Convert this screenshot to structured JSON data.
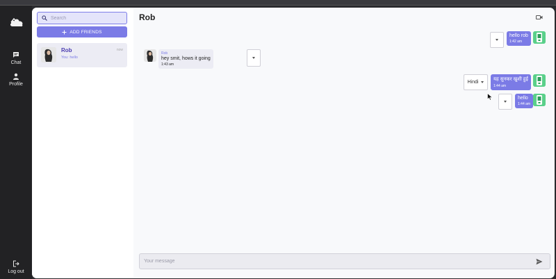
{
  "rail": {
    "chat_label": "Chat",
    "profile_label": "Profile",
    "logout_label": "Log out"
  },
  "friends_panel": {
    "search_placeholder": "Search",
    "add_friends_label": "ADD FRIENDS",
    "friends": [
      {
        "name": "Rob",
        "preview": "You: hello",
        "time": "now"
      }
    ]
  },
  "chat": {
    "title": "Rob",
    "messages": [
      {
        "direction": "outgoing",
        "text": "hello rob",
        "time": "1:42 am"
      },
      {
        "direction": "incoming",
        "sender": "Rob",
        "text": "hey smit, hows it going",
        "time": "1:43 am"
      },
      {
        "direction": "outgoing",
        "text": "यह सुनकर खुशी हुई",
        "time": "1:44 am",
        "language": "Hindi"
      },
      {
        "direction": "outgoing",
        "text": "hello",
        "time": "1:44 am"
      }
    ],
    "compose_placeholder": "Your message"
  },
  "colors": {
    "accent": "#7b7be6",
    "rail_bg": "#222224",
    "avatar_green": "#5ad08a"
  },
  "icons": [
    "cloud-logo-icon",
    "chat-icon",
    "profile-icon",
    "logout-icon",
    "search-icon",
    "plus-icon",
    "video-call-icon",
    "chevron-down-icon",
    "send-icon"
  ]
}
